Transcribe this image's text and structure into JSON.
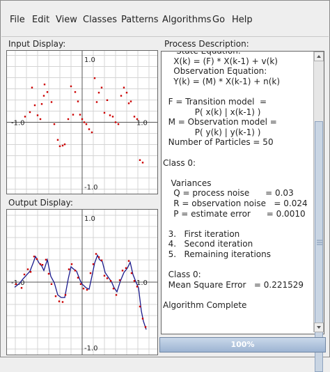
{
  "menu": [
    "File",
    "Edit",
    "View",
    "Classes",
    "Patterns",
    "Algorithms",
    "Go",
    "Help"
  ],
  "input_display": {
    "label": "Input Display:",
    "tick_top": "1.0",
    "tick_left": "-1.0",
    "tick_right": "1.0",
    "tick_bottom": "-1.0",
    "point_color": "#cc0000",
    "points": [
      [
        -0.82,
        0.09
      ],
      [
        -0.75,
        0.16
      ],
      [
        -0.72,
        0.55
      ],
      [
        -0.68,
        0.27
      ],
      [
        -0.64,
        0.11
      ],
      [
        -0.6,
        0.05
      ],
      [
        -0.58,
        0.29
      ],
      [
        -0.55,
        0.42
      ],
      [
        -0.54,
        0.6
      ],
      [
        -0.5,
        0.48
      ],
      [
        -0.44,
        0.32
      ],
      [
        -0.4,
        -0.03
      ],
      [
        -0.35,
        -0.28
      ],
      [
        -0.32,
        -0.38
      ],
      [
        -0.28,
        -0.37
      ],
      [
        -0.25,
        -0.35
      ],
      [
        -0.2,
        0.05
      ],
      [
        -0.16,
        0.57
      ],
      [
        -0.13,
        0.12
      ],
      [
        -0.1,
        0.48
      ],
      [
        -0.06,
        0.33
      ],
      [
        -0.03,
        0.12
      ],
      [
        0.0,
        0.05
      ],
      [
        0.03,
        0.0
      ],
      [
        0.06,
        -0.03
      ],
      [
        0.1,
        -0.11
      ],
      [
        0.14,
        -0.16
      ],
      [
        0.18,
        0.7
      ],
      [
        0.21,
        0.32
      ],
      [
        0.24,
        0.47
      ],
      [
        0.28,
        0.55
      ],
      [
        0.32,
        0.15
      ],
      [
        0.36,
        0.35
      ],
      [
        0.4,
        0.11
      ],
      [
        0.44,
        0.09
      ],
      [
        0.48,
        0.0
      ],
      [
        0.52,
        -0.03
      ],
      [
        0.56,
        0.42
      ],
      [
        0.6,
        0.55
      ],
      [
        0.64,
        0.47
      ],
      [
        0.67,
        0.3
      ],
      [
        0.7,
        0.33
      ],
      [
        0.75,
        0.09
      ],
      [
        0.79,
        0.05
      ],
      [
        0.83,
        -0.6
      ],
      [
        0.87,
        -0.64
      ]
    ]
  },
  "output_display": {
    "label": "Output Display:",
    "tick_top": "1.0",
    "tick_left": "-1.0",
    "tick_right": "1.0",
    "tick_bottom": "-1.0",
    "point_color": "#cc0000",
    "line_color": "#1a1a8c",
    "curve": [
      [
        -0.97,
        -0.08
      ],
      [
        -0.9,
        -0.02
      ],
      [
        -0.85,
        0.05
      ],
      [
        -0.8,
        0.11
      ],
      [
        -0.75,
        0.17
      ],
      [
        -0.7,
        0.31
      ],
      [
        -0.67,
        0.4
      ],
      [
        -0.62,
        0.3
      ],
      [
        -0.58,
        0.25
      ],
      [
        -0.55,
        0.18
      ],
      [
        -0.5,
        0.35
      ],
      [
        -0.45,
        0.09
      ],
      [
        -0.4,
        -0.01
      ],
      [
        -0.35,
        -0.2
      ],
      [
        -0.3,
        -0.24
      ],
      [
        -0.25,
        -0.24
      ],
      [
        -0.2,
        0.05
      ],
      [
        -0.16,
        0.24
      ],
      [
        -0.13,
        0.21
      ],
      [
        -0.08,
        0.17
      ],
      [
        -0.03,
        0.03
      ],
      [
        0.0,
        -0.03
      ],
      [
        0.06,
        -0.09
      ],
      [
        0.1,
        -0.11
      ],
      [
        0.14,
        0.09
      ],
      [
        0.18,
        0.3
      ],
      [
        0.22,
        0.42
      ],
      [
        0.25,
        0.35
      ],
      [
        0.29,
        0.32
      ],
      [
        0.33,
        0.15
      ],
      [
        0.38,
        0.07
      ],
      [
        0.42,
        0.01
      ],
      [
        0.46,
        -0.09
      ],
      [
        0.5,
        -0.15
      ],
      [
        0.55,
        0.02
      ],
      [
        0.6,
        0.15
      ],
      [
        0.65,
        0.22
      ],
      [
        0.69,
        0.31
      ],
      [
        0.73,
        0.12
      ],
      [
        0.77,
        0.01
      ],
      [
        0.81,
        -0.09
      ],
      [
        0.85,
        -0.45
      ],
      [
        0.88,
        -0.61
      ],
      [
        0.92,
        -0.74
      ]
    ],
    "points": [
      [
        -0.95,
        -0.03
      ],
      [
        -0.87,
        -0.09
      ],
      [
        -0.83,
        0.12
      ],
      [
        -0.78,
        0.2
      ],
      [
        -0.74,
        0.16
      ],
      [
        -0.69,
        0.4
      ],
      [
        -0.65,
        0.36
      ],
      [
        -0.6,
        0.28
      ],
      [
        -0.57,
        0.27
      ],
      [
        -0.52,
        0.35
      ],
      [
        -0.48,
        0.13
      ],
      [
        -0.44,
        -0.03
      ],
      [
        -0.38,
        -0.22
      ],
      [
        -0.33,
        -0.3
      ],
      [
        -0.28,
        -0.31
      ],
      [
        -0.24,
        -0.2
      ],
      [
        -0.19,
        0.2
      ],
      [
        -0.15,
        0.28
      ],
      [
        -0.1,
        0.18
      ],
      [
        -0.06,
        0.07
      ],
      [
        -0.02,
        -0.03
      ],
      [
        0.02,
        -0.1
      ],
      [
        0.07,
        -0.12
      ],
      [
        0.12,
        0.14
      ],
      [
        0.16,
        0.28
      ],
      [
        0.2,
        0.44
      ],
      [
        0.24,
        0.39
      ],
      [
        0.28,
        0.34
      ],
      [
        0.32,
        0.1
      ],
      [
        0.36,
        0.06
      ],
      [
        0.41,
        0.02
      ],
      [
        0.45,
        -0.1
      ],
      [
        0.49,
        -0.2
      ],
      [
        0.54,
        0.03
      ],
      [
        0.58,
        0.18
      ],
      [
        0.63,
        0.22
      ],
      [
        0.67,
        0.33
      ],
      [
        0.71,
        0.14
      ],
      [
        0.75,
        0.02
      ],
      [
        0.79,
        -0.07
      ],
      [
        0.83,
        -0.38
      ],
      [
        0.87,
        -0.57
      ],
      [
        0.91,
        -0.7
      ]
    ]
  },
  "process_description": {
    "label": "Process Description:",
    "text": "     State Equation:\n    X(k) = (F) * X(k-1) + v(k)\n    Observation Equation:\n    Y(k) = (M) * X(k-1) + n(k)\n\n  F = Transition model  =\n            P( x(k) | x(k-1) )\n  M = Observation model =\n            P( y(k) | y(k-1) )\n  Number of Particles = 50\n\nClass 0:\n\n   Variances\n    Q = process noise      = 0.03\n    R = observation noise   = 0.024\n    P = estimate error      = 0.0010\n\n  3.   First iteration\n  4.   Second iteration\n  5.   Remaining iterations\n\n  Class 0:\n  Mean Square Error   = 0.221529\n\nAlgorithm Complete"
  },
  "progress": {
    "label": "100%",
    "value": 1.0,
    "fill_color": "#a9bfd9"
  }
}
